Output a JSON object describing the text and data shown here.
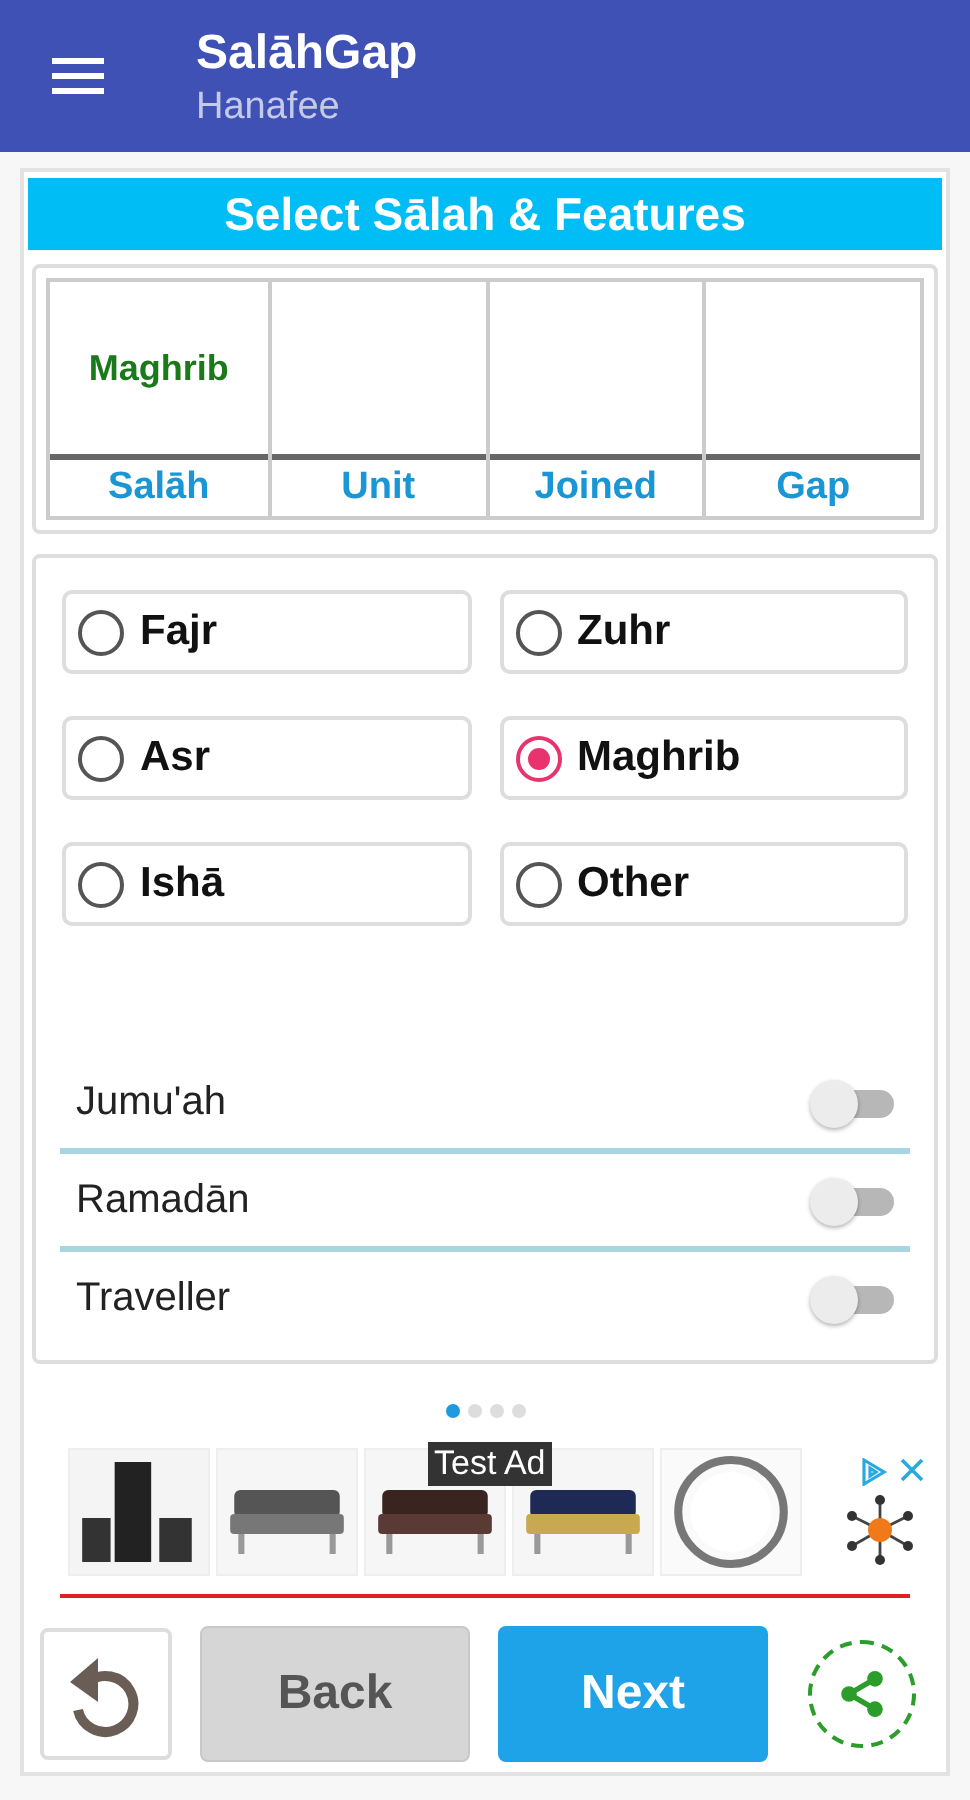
{
  "app_bar": {
    "title": "SalāhGap",
    "subtitle": "Hanafee"
  },
  "heading": "Select Sālah & Features",
  "summary": {
    "columns": [
      {
        "value": "Maghrib",
        "label": "Salāh"
      },
      {
        "label": "Unit"
      },
      {
        "label": "Joined"
      },
      {
        "label": "Gap"
      }
    ]
  },
  "prayers": [
    {
      "label": "Fajr",
      "selected": false
    },
    {
      "label": "Zuhr",
      "selected": false
    },
    {
      "label": "Asr",
      "selected": false
    },
    {
      "label": "Maghrib",
      "selected": true
    },
    {
      "label": "Ishā",
      "selected": false
    },
    {
      "label": "Other",
      "selected": false
    }
  ],
  "features": [
    {
      "label": "Jumu'ah",
      "on": false
    },
    {
      "label": "Ramadān",
      "on": false
    },
    {
      "label": "Traveller",
      "on": false
    }
  ],
  "pager": [
    {
      "selected": true
    },
    {
      "selected": false
    },
    {
      "selected": false
    },
    {
      "selected": false
    }
  ],
  "ad": {
    "label": "Test Ad"
  },
  "buttons": {
    "back": "Back",
    "next": "Next"
  }
}
